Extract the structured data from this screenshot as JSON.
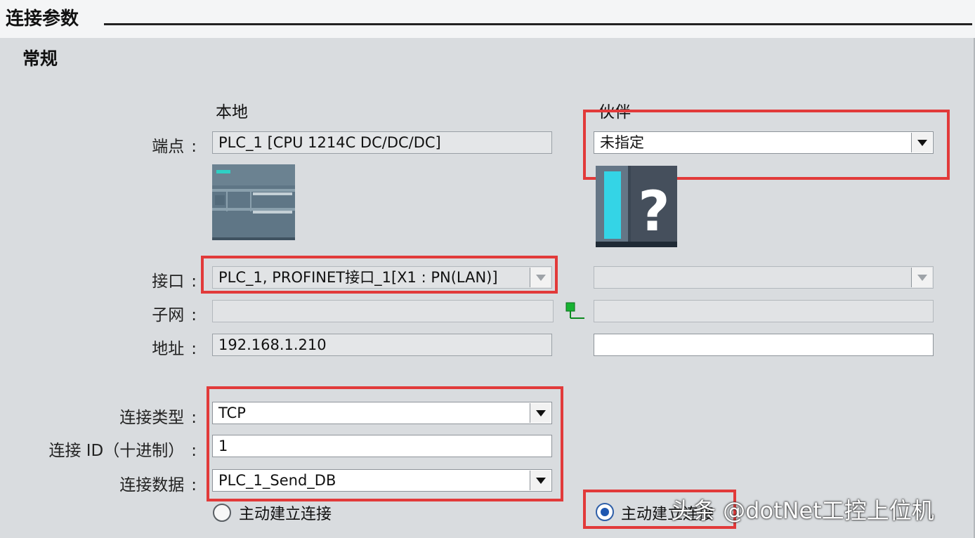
{
  "header": {
    "title": "连接参数"
  },
  "section": {
    "title": "常规"
  },
  "columns": {
    "local": "本地",
    "partner": "伙伴"
  },
  "labels": {
    "endpoint": "端点",
    "interface": "接口",
    "subnet": "子网",
    "address": "地址",
    "conn_type": "连接类型",
    "conn_id": "连接 ID（十进制）",
    "conn_data": "连接数据",
    "colon": ":"
  },
  "local": {
    "endpoint": "PLC_1 [CPU 1214C DC/DC/DC]",
    "interface": "PLC_1, PROFINET接口_1[X1 : PN(LAN)]",
    "subnet": "",
    "address": "192.168.1.210",
    "conn_type": "TCP",
    "conn_id": "1",
    "conn_data": "PLC_1_Send_DB",
    "active_label": "主动建立连接",
    "active_checked": false
  },
  "partner": {
    "endpoint": "未指定",
    "interface": "",
    "subnet": "",
    "address": "",
    "active_label": "主动建立连接",
    "active_checked": true,
    "device_icon_symbol": "?"
  },
  "icons": {
    "local_device": "plc-device-icon",
    "partner_device": "unknown-device-icon",
    "subnet": "network-node-icon"
  },
  "colors": {
    "highlight": "#e23a3a",
    "radio_selected": "#1f57b0"
  },
  "watermark": "头条 @dotNet工控上位机"
}
